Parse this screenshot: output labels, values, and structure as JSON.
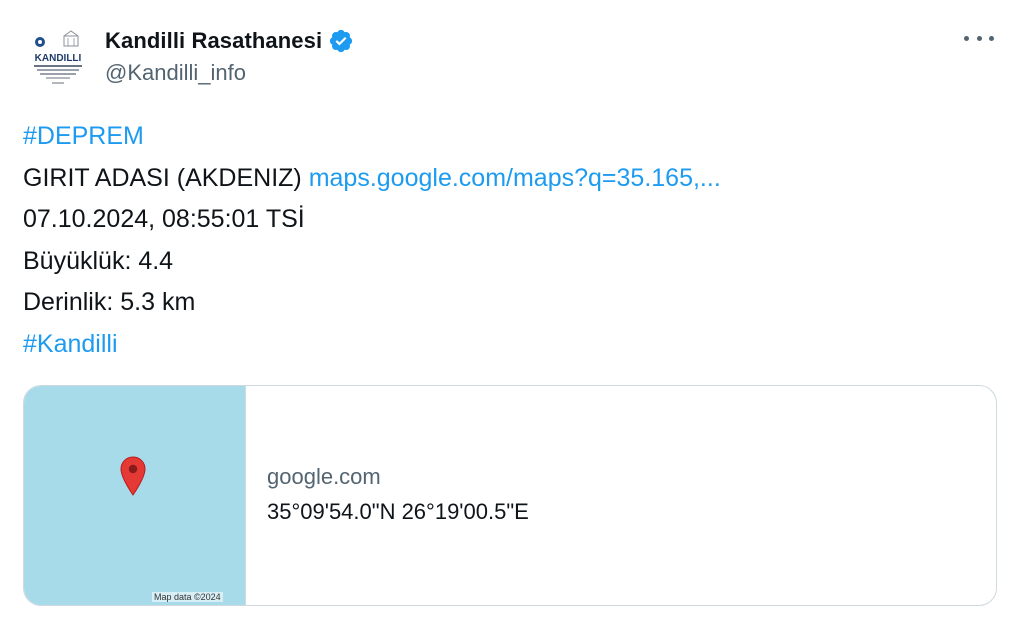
{
  "author": {
    "display_name": "Kandilli Rasathanesi",
    "handle": "@Kandilli_info",
    "avatar_text": "KANDILLI",
    "verified": true
  },
  "menu": {
    "more_icon": "more-horizontal-icon"
  },
  "tweet": {
    "hashtag_top": "#DEPREM",
    "location": "GIRIT ADASI (AKDENIZ) ",
    "map_link": "maps.google.com/maps?q=35.165,...",
    "datetime": "07.10.2024, 08:55:01 TSİ",
    "magnitude": "Büyüklük: 4.4",
    "depth": "Derinlik: 5.3 km",
    "hashtag_bottom": "#Kandilli"
  },
  "card": {
    "domain": "google.com",
    "title": "35°09'54.0\"N 26°19'00.5\"E",
    "map_attribution": "Map data ©2024",
    "map_color": "#a8dbea",
    "pin_color": "#e53935"
  },
  "colors": {
    "link": "#1d9bf0",
    "text": "#0f1419",
    "muted": "#536471",
    "border": "#cfd9de"
  }
}
